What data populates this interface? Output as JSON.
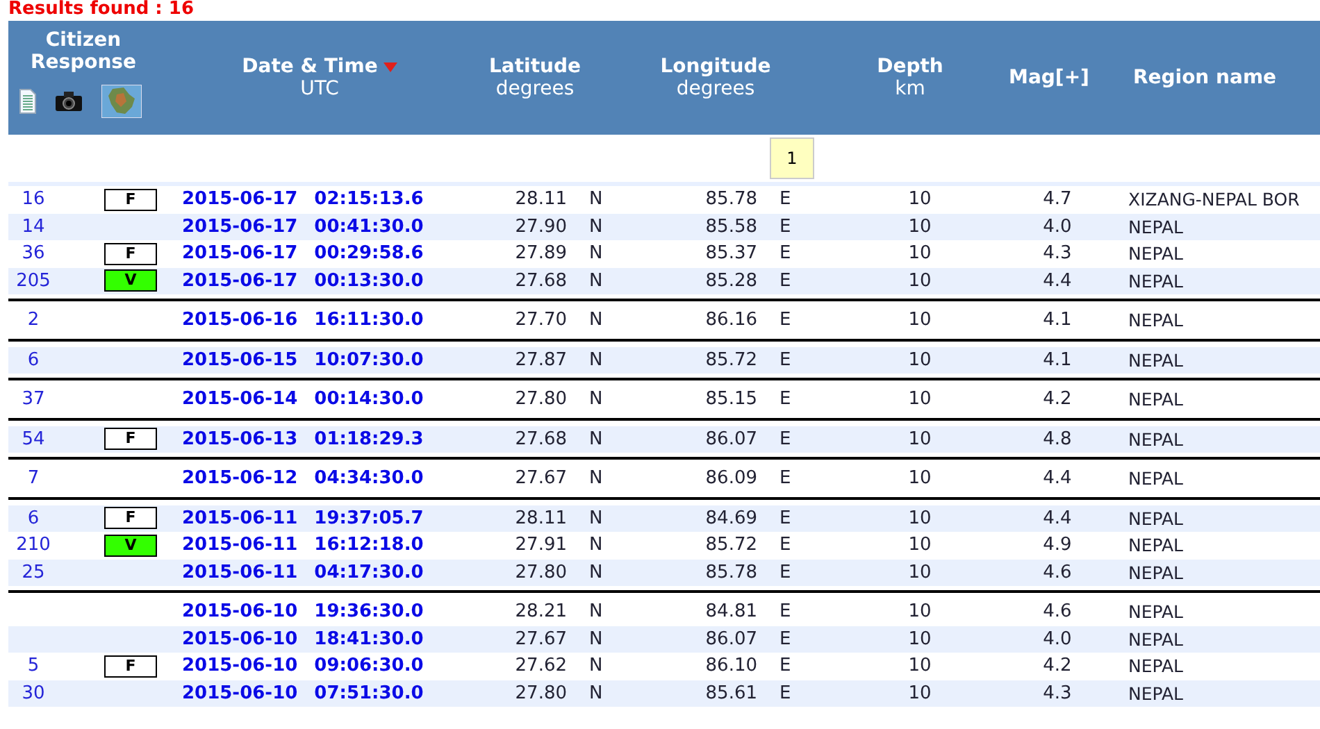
{
  "results_found": "Results found : 16",
  "columns": [
    {
      "title": "Citizen Response",
      "kind": "icons"
    },
    {
      "title": "Date & Time",
      "subtitle": "UTC",
      "sorted": true,
      "kind": "text"
    },
    {
      "title": "Latitude",
      "subtitle": "degrees",
      "kind": "text"
    },
    {
      "title": "Longitude",
      "subtitle": "degrees",
      "kind": "text"
    },
    {
      "title": "Depth",
      "subtitle": "km",
      "kind": "text"
    },
    {
      "title": "Mag[+]",
      "kind": "text"
    },
    {
      "title": "Region name",
      "kind": "text"
    }
  ],
  "pages": [
    {
      "label": "1",
      "selected": true
    }
  ],
  "groups": [
    {
      "rows": [
        {
          "responses": "16",
          "badge": {
            "label": "F",
            "color": "#ffffff"
          },
          "date": "2015-06-17",
          "time": "02:15:13.6",
          "lat": "28.11",
          "lat_hemi": "N",
          "lon": "85.78",
          "lon_hemi": "E",
          "depth": "10",
          "mag": "4.7",
          "region": "XIZANG-NEPAL BOR"
        },
        {
          "responses": "14",
          "date": "2015-06-17",
          "time": "00:41:30.0",
          "lat": "27.90",
          "lat_hemi": "N",
          "lon": "85.58",
          "lon_hemi": "E",
          "depth": "10",
          "mag": "4.0",
          "region": "NEPAL"
        },
        {
          "responses": "36",
          "badge": {
            "label": "F",
            "color": "#ffffff"
          },
          "date": "2015-06-17",
          "time": "00:29:58.6",
          "lat": "27.89",
          "lat_hemi": "N",
          "lon": "85.37",
          "lon_hemi": "E",
          "depth": "10",
          "mag": "4.3",
          "region": "NEPAL"
        },
        {
          "responses": "205",
          "badge": {
            "label": "V",
            "color": "#33ff00"
          },
          "date": "2015-06-17",
          "time": "00:13:30.0",
          "lat": "27.68",
          "lat_hemi": "N",
          "lon": "85.28",
          "lon_hemi": "E",
          "depth": "10",
          "mag": "4.4",
          "region": "NEPAL"
        }
      ]
    },
    {
      "rows": [
        {
          "responses": "2",
          "date": "2015-06-16",
          "time": "16:11:30.0",
          "lat": "27.70",
          "lat_hemi": "N",
          "lon": "86.16",
          "lon_hemi": "E",
          "depth": "10",
          "mag": "4.1",
          "region": "NEPAL"
        }
      ]
    },
    {
      "rows": [
        {
          "responses": "6",
          "date": "2015-06-15",
          "time": "10:07:30.0",
          "lat": "27.87",
          "lat_hemi": "N",
          "lon": "85.72",
          "lon_hemi": "E",
          "depth": "10",
          "mag": "4.1",
          "region": "NEPAL"
        }
      ]
    },
    {
      "rows": [
        {
          "responses": "37",
          "date": "2015-06-14",
          "time": "00:14:30.0",
          "lat": "27.80",
          "lat_hemi": "N",
          "lon": "85.15",
          "lon_hemi": "E",
          "depth": "10",
          "mag": "4.2",
          "region": "NEPAL"
        }
      ]
    },
    {
      "rows": [
        {
          "responses": "54",
          "badge": {
            "label": "F",
            "color": "#ffffff"
          },
          "date": "2015-06-13",
          "time": "01:18:29.3",
          "lat": "27.68",
          "lat_hemi": "N",
          "lon": "86.07",
          "lon_hemi": "E",
          "depth": "10",
          "mag": "4.8",
          "region": "NEPAL"
        }
      ]
    },
    {
      "rows": [
        {
          "responses": "7",
          "date": "2015-06-12",
          "time": "04:34:30.0",
          "lat": "27.67",
          "lat_hemi": "N",
          "lon": "86.09",
          "lon_hemi": "E",
          "depth": "10",
          "mag": "4.4",
          "region": "NEPAL"
        }
      ]
    },
    {
      "rows": [
        {
          "responses": "6",
          "badge": {
            "label": "F",
            "color": "#ffffff"
          },
          "date": "2015-06-11",
          "time": "19:37:05.7",
          "lat": "28.11",
          "lat_hemi": "N",
          "lon": "84.69",
          "lon_hemi": "E",
          "depth": "10",
          "mag": "4.4",
          "region": "NEPAL"
        },
        {
          "responses": "210",
          "badge": {
            "label": "V",
            "color": "#33ff00"
          },
          "date": "2015-06-11",
          "time": "16:12:18.0",
          "lat": "27.91",
          "lat_hemi": "N",
          "lon": "85.72",
          "lon_hemi": "E",
          "depth": "10",
          "mag": "4.9",
          "region": "NEPAL"
        },
        {
          "responses": "25",
          "date": "2015-06-11",
          "time": "04:17:30.0",
          "lat": "27.80",
          "lat_hemi": "N",
          "lon": "85.78",
          "lon_hemi": "E",
          "depth": "10",
          "mag": "4.6",
          "region": "NEPAL"
        }
      ]
    },
    {
      "rows": [
        {
          "date": "2015-06-10",
          "time": "19:36:30.0",
          "lat": "28.21",
          "lat_hemi": "N",
          "lon": "84.81",
          "lon_hemi": "E",
          "depth": "10",
          "mag": "4.6",
          "region": "NEPAL"
        },
        {
          "date": "2015-06-10",
          "time": "18:41:30.0",
          "lat": "27.67",
          "lat_hemi": "N",
          "lon": "86.07",
          "lon_hemi": "E",
          "depth": "10",
          "mag": "4.0",
          "region": "NEPAL"
        },
        {
          "responses": "5",
          "badge": {
            "label": "F",
            "color": "#ffffff"
          },
          "date": "2015-06-10",
          "time": "09:06:30.0",
          "lat": "27.62",
          "lat_hemi": "N",
          "lon": "86.10",
          "lon_hemi": "E",
          "depth": "10",
          "mag": "4.2",
          "region": "NEPAL"
        },
        {
          "responses": "30",
          "date": "2015-06-10",
          "time": "07:51:30.0",
          "lat": "27.80",
          "lat_hemi": "N",
          "lon": "85.61",
          "lon_hemi": "E",
          "depth": "10",
          "mag": "4.3",
          "region": "NEPAL"
        }
      ]
    }
  ]
}
